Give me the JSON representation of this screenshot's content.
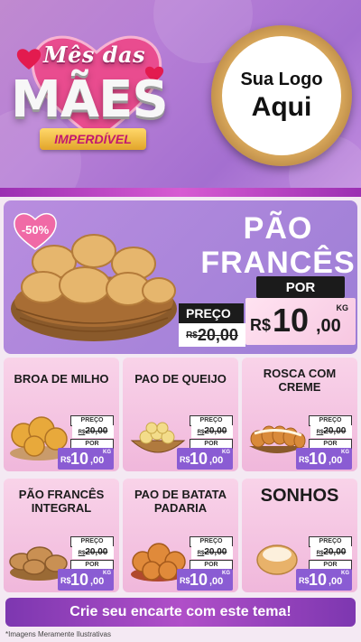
{
  "header": {
    "title_line1": "Mês das",
    "title_line2": "MÃES",
    "ribbon": "IMPERDÍVEL",
    "logo_line1": "Sua Logo",
    "logo_line2": "Aqui"
  },
  "hero": {
    "discount_badge": "-50%",
    "title_line1": "PÃO",
    "title_line2": "FRANCÊS",
    "preco_label": "PREÇO",
    "por_label": "POR",
    "old_currency": "R$",
    "old_value": "20,00",
    "new_currency": "R$",
    "new_value": "10",
    "new_decimals": ",00",
    "unit": "KG"
  },
  "cards": [
    {
      "name": "BROA DE MILHO",
      "preco_label": "PREÇO",
      "old_currency": "R$",
      "old_value": "20,00",
      "por_label": "POR",
      "new_currency": "R$",
      "new_value": "10",
      "new_decimals": ",00",
      "unit": "KG"
    },
    {
      "name": "PAO DE QUEIJO",
      "preco_label": "PREÇO",
      "old_currency": "R$",
      "old_value": "20,00",
      "por_label": "POR",
      "new_currency": "R$",
      "new_value": "10",
      "new_decimals": ",00",
      "unit": "KG"
    },
    {
      "name": "ROSCA COM CREME",
      "preco_label": "PREÇO",
      "old_currency": "R$",
      "old_value": "20,00",
      "por_label": "POR",
      "new_currency": "R$",
      "new_value": "10",
      "new_decimals": ",00",
      "unit": "KG"
    },
    {
      "name": "PÃO FRANCÊS INTEGRAL",
      "preco_label": "PREÇO",
      "old_currency": "R$",
      "old_value": "20,00",
      "por_label": "POR",
      "new_currency": "R$",
      "new_value": "10",
      "new_decimals": ",00",
      "unit": "KG"
    },
    {
      "name": "PAO DE BATATA PADARIA",
      "preco_label": "PREÇO",
      "old_currency": "R$",
      "old_value": "20,00",
      "por_label": "POR",
      "new_currency": "R$",
      "new_value": "10",
      "new_decimals": ",00",
      "unit": "KG"
    },
    {
      "name": "SONHOS",
      "preco_label": "PREÇO",
      "old_currency": "R$",
      "old_value": "20,00",
      "por_label": "POR",
      "new_currency": "R$",
      "new_value": "10",
      "new_decimals": ",00",
      "unit": "KG"
    }
  ],
  "cta": "Crie seu encarte com este tema!",
  "footnote": "*Imagens Meramente Ilustrativas",
  "colors": {
    "header_purple": "#b77fd6",
    "hero_purple": "#9c7ed6",
    "card_pink": "#f0b7db",
    "price_purple": "#8a5cd3",
    "heart_pink": "#e94c8f",
    "ribbon_gold": "#e2a52a"
  }
}
